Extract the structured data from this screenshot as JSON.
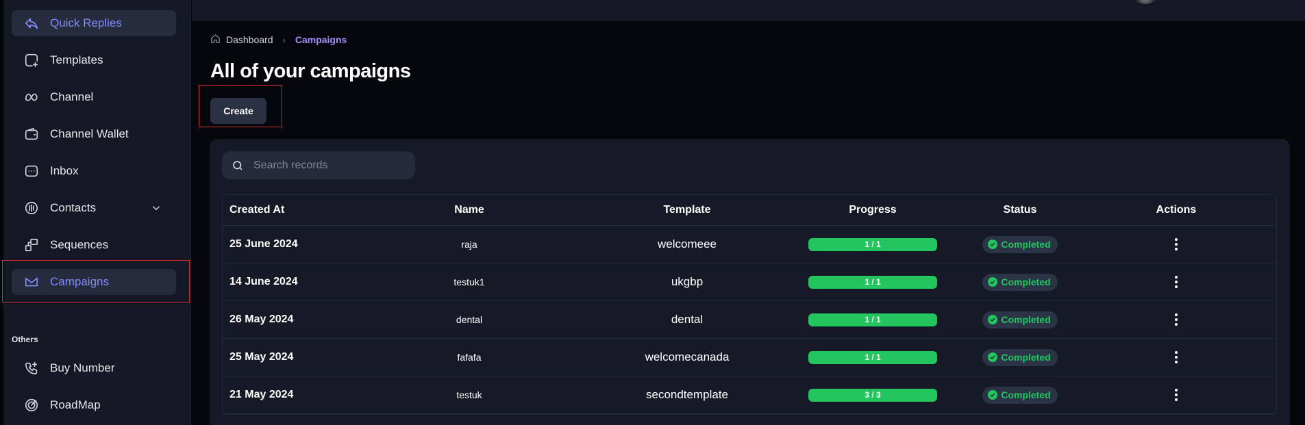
{
  "sidebar": {
    "items": [
      {
        "label": "Quick Replies",
        "icon": "reply-icon"
      },
      {
        "label": "Templates",
        "icon": "template-icon"
      },
      {
        "label": "Channel",
        "icon": "meta-icon"
      },
      {
        "label": "Channel Wallet",
        "icon": "wallet-icon"
      },
      {
        "label": "Inbox",
        "icon": "inbox-icon"
      },
      {
        "label": "Contacts",
        "icon": "contacts-icon"
      },
      {
        "label": "Sequences",
        "icon": "sequences-icon"
      },
      {
        "label": "Campaigns",
        "icon": "campaigns-icon"
      }
    ],
    "others_label": "Others",
    "others": [
      {
        "label": "Buy Number",
        "icon": "phone-plus-icon"
      },
      {
        "label": "RoadMap",
        "icon": "target-icon"
      }
    ],
    "active": "Campaigns"
  },
  "breadcrumb": {
    "home": "Dashboard",
    "current": "Campaigns"
  },
  "page": {
    "title": "All of your campaigns",
    "create_label": "Create"
  },
  "search": {
    "placeholder": "Search records",
    "value": ""
  },
  "table": {
    "headers": {
      "created_at": "Created At",
      "name": "Name",
      "template": "Template",
      "progress": "Progress",
      "status": "Status",
      "actions": "Actions"
    },
    "rows": [
      {
        "created_at": "25 June 2024",
        "name": "raja",
        "template": "welcomeee",
        "progress": "1 / 1",
        "progress_fraction": 1,
        "status": "Completed"
      },
      {
        "created_at": "14 June 2024",
        "name": "testuk1",
        "template": "ukgbp",
        "progress": "1 / 1",
        "progress_fraction": 1,
        "status": "Completed"
      },
      {
        "created_at": "26 May 2024",
        "name": "dental",
        "template": "dental",
        "progress": "1 / 1",
        "progress_fraction": 1,
        "status": "Completed"
      },
      {
        "created_at": "25 May 2024",
        "name": "fafafa",
        "template": "welcomecanada",
        "progress": "1 / 1",
        "progress_fraction": 1,
        "status": "Completed"
      },
      {
        "created_at": "21 May 2024",
        "name": "testuk",
        "template": "secondtemplate",
        "progress": "3 / 3",
        "progress_fraction": 1,
        "status": "Completed"
      }
    ]
  },
  "colors": {
    "accent": "#818cf8",
    "breadcrumb_active": "#a78bfa",
    "success": "#22c55e",
    "highlight": "#d32f2f"
  }
}
